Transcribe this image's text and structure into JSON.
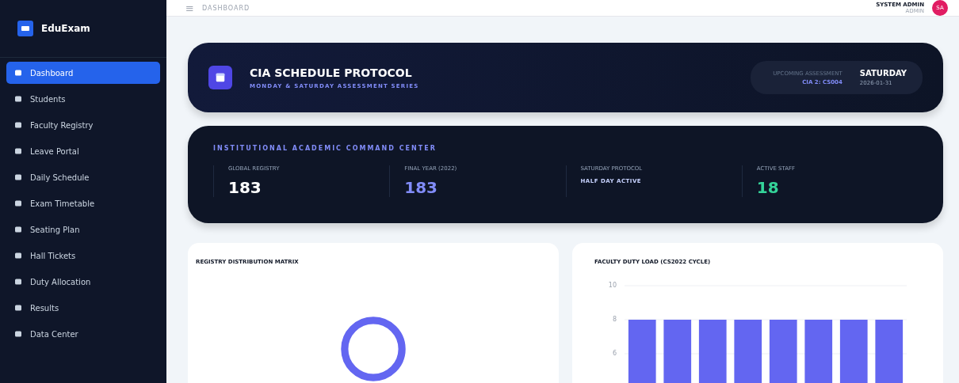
{
  "brand": {
    "name": "EduExam"
  },
  "sidebar": {
    "items": [
      {
        "label": "Dashboard",
        "selected": true
      },
      {
        "label": "Students",
        "selected": false
      },
      {
        "label": "Faculty Registry",
        "selected": false
      },
      {
        "label": "Leave Portal",
        "selected": false
      },
      {
        "label": "Daily Schedule",
        "selected": false
      },
      {
        "label": "Exam Timetable",
        "selected": false
      },
      {
        "label": "Seating Plan",
        "selected": false
      },
      {
        "label": "Hall Tickets",
        "selected": false
      },
      {
        "label": "Duty Allocation",
        "selected": false
      },
      {
        "label": "Results",
        "selected": false
      },
      {
        "label": "Data Center",
        "selected": false
      }
    ]
  },
  "topbar": {
    "menu_glyph": "≡",
    "breadcrumb": "DASHBOARD",
    "user_name": "SYSTEM ADMIN",
    "user_role": "ADMIN",
    "avatar": "SA"
  },
  "banner": {
    "title": "CIA SCHEDULE PROTOCOL",
    "subtitle": "MONDAY & SATURDAY ASSESSMENT SERIES",
    "assessment_label": "UPCOMING ASSESSMENT",
    "assessment": "CIA 2: CS004",
    "day": "SATURDAY",
    "date": "2026-01-31"
  },
  "command_center": {
    "title": "INSTITUTIONAL ACADEMIC COMMAND CENTER",
    "stats": [
      {
        "label": "GLOBAL REGISTRY",
        "value": "183",
        "color": "#ffffff"
      },
      {
        "label": "FINAL YEAR (2022)",
        "value": "183",
        "color": "#818cf8"
      },
      {
        "label": "SATURDAY PROTOCOL",
        "value": "HALF DAY ACTIVE",
        "color": "#c7d2fe"
      },
      {
        "label": "ACTIVE STAFF",
        "value": "18",
        "color": "#34d399"
      }
    ]
  },
  "distribution": {
    "title": "REGISTRY DISTRIBUTION MATRIX"
  },
  "duty_load": {
    "title": "FACULTY DUTY LOAD (CS2022 CYCLE)",
    "chart_data": {
      "type": "bar",
      "series": [
        {
          "color": "#6366f1",
          "values": [
            8,
            8,
            8,
            8,
            8,
            8,
            8,
            8
          ]
        }
      ],
      "yticks": [
        6,
        8,
        10
      ],
      "ylim": [
        0,
        10
      ]
    }
  }
}
